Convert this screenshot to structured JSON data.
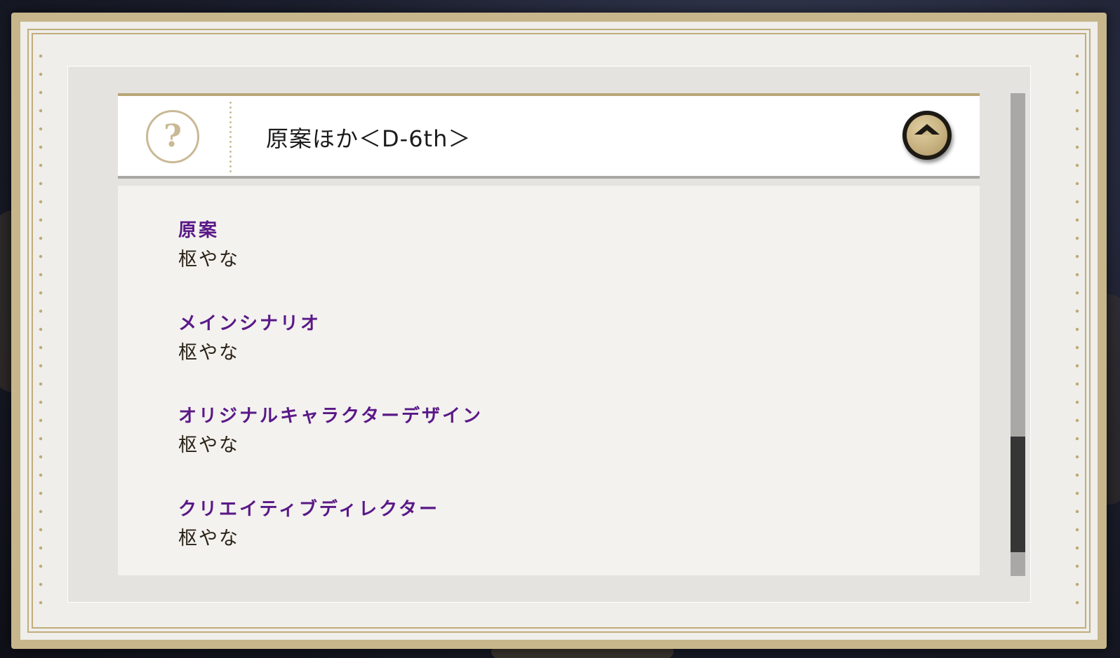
{
  "header": {
    "title": "原案ほか＜D-6th＞",
    "help_icon_glyph": "?",
    "collapse_icon": "chevron-up-icon"
  },
  "credits": [
    {
      "role": "原案",
      "name": "枢やな"
    },
    {
      "role": "メインシナリオ",
      "name": "枢やな"
    },
    {
      "role": "オリジナルキャラクターデザイン",
      "name": "枢やな"
    },
    {
      "role": "クリエイティブディレクター",
      "name": "枢やな"
    }
  ],
  "colors": {
    "role_text": "#5a1887",
    "name_text": "#2b2216",
    "gold_accent": "#c7b68c",
    "paper": "#efeeea"
  },
  "scroll": {
    "position_fraction": 0.95
  }
}
